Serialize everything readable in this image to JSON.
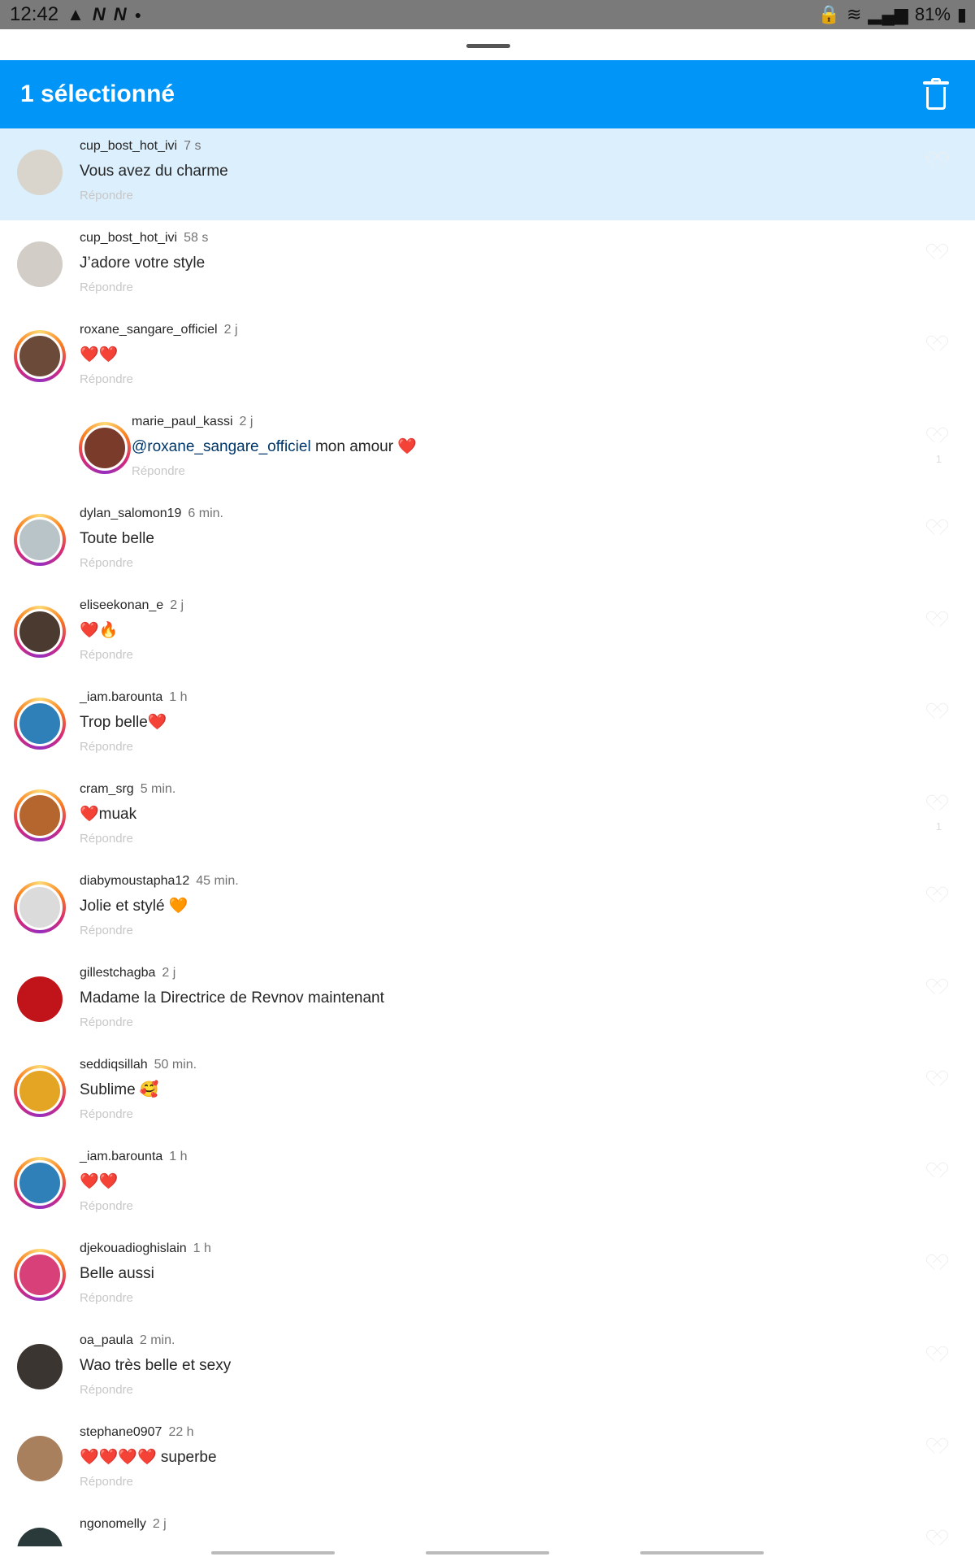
{
  "status_bar": {
    "time": "12:42",
    "icons": [
      "warning-icon",
      "n-icon",
      "n-icon",
      "dot-icon"
    ],
    "right_icons": [
      "lock-icon",
      "wifi-icon",
      "signal-icon"
    ],
    "battery": "81%"
  },
  "header": {
    "title": "1 sélectionné",
    "background": "#0095f6",
    "delete_icon": "trash-icon"
  },
  "comments": [
    {
      "user": "cup_bost_hot_ivi",
      "time": "7 s",
      "text": "Vous avez du charme",
      "reply": "Répondre",
      "selected": true,
      "ring": false,
      "avatar_color": "#d9d4cc",
      "likes": ""
    },
    {
      "user": "cup_bost_hot_ivi",
      "time": "58 s",
      "text": "J’adore votre style",
      "reply": "Répondre",
      "selected": false,
      "ring": false,
      "avatar_color": "#d2cdc6",
      "likes": ""
    },
    {
      "user": "roxane_sangare_officiel",
      "time": "2 j",
      "text": "❤️❤️",
      "reply": "Répondre",
      "selected": false,
      "ring": true,
      "avatar_color": "#6b4a3a",
      "likes": ""
    },
    {
      "user": "marie_paul_kassi",
      "time": "2 j",
      "mention": "@roxane_sangare_officiel",
      "text": " mon amour ❤️",
      "reply": "Répondre",
      "selected": false,
      "ring": true,
      "avatar_color": "#7b3b2a",
      "likes": "1",
      "nested": true
    },
    {
      "user": "dylan_salomon19",
      "time": "6 min.",
      "text": "Toute belle",
      "reply": "Répondre",
      "selected": false,
      "ring": true,
      "avatar_color": "#b9c4c9",
      "likes": ""
    },
    {
      "user": "eliseekonan_e",
      "time": "2 j",
      "text": "❤️🔥",
      "reply": "Répondre",
      "selected": false,
      "ring": true,
      "avatar_color": "#4a3a30",
      "likes": ""
    },
    {
      "user": "_iam.barounta",
      "time": "1 h",
      "text": "Trop belle❤️",
      "reply": "Répondre",
      "selected": false,
      "ring": true,
      "avatar_color": "#2f7fb8",
      "likes": ""
    },
    {
      "user": "cram_srg",
      "time": "5 min.",
      "text": "❤️muak",
      "reply": "Répondre",
      "selected": false,
      "ring": true,
      "avatar_color": "#b5652e",
      "likes": "1"
    },
    {
      "user": "diabymoustapha12",
      "time": "45 min.",
      "text": "Jolie et stylé 🧡",
      "reply": "Répondre",
      "selected": false,
      "ring": true,
      "avatar_color": "#dbdbdb",
      "likes": ""
    },
    {
      "user": "gillestchagba",
      "time": "2 j",
      "text": "Madame la Directrice de  Revnov maintenant",
      "reply": "Répondre",
      "selected": false,
      "ring": false,
      "avatar_color": "#c0141a",
      "likes": ""
    },
    {
      "user": "seddiqsillah",
      "time": "50 min.",
      "text": "Sublime 🥰",
      "reply": "Répondre",
      "selected": false,
      "ring": true,
      "avatar_color": "#e5a524",
      "likes": ""
    },
    {
      "user": "_iam.barounta",
      "time": "1 h",
      "text": "❤️❤️",
      "reply": "Répondre",
      "selected": false,
      "ring": true,
      "avatar_color": "#2f7fb8",
      "likes": ""
    },
    {
      "user": "djekouadioghislain",
      "time": "1 h",
      "text": "Belle aussi",
      "reply": "Répondre",
      "selected": false,
      "ring": true,
      "avatar_color": "#d8407a",
      "likes": ""
    },
    {
      "user": "oa_paula",
      "time": "2 min.",
      "text": "Wao très belle et sexy",
      "reply": "Répondre",
      "selected": false,
      "ring": false,
      "avatar_color": "#3a3530",
      "likes": ""
    },
    {
      "user": "stephane0907",
      "time": "22 h",
      "text": "❤️❤️❤️❤️ superbe",
      "reply": "Répondre",
      "selected": false,
      "ring": false,
      "avatar_color": "#a9805e",
      "likes": ""
    },
    {
      "user": "ngonomelly",
      "time": "2 j",
      "text": "",
      "reply": "",
      "selected": false,
      "ring": false,
      "avatar_color": "#2a3a3a",
      "likes": ""
    }
  ]
}
